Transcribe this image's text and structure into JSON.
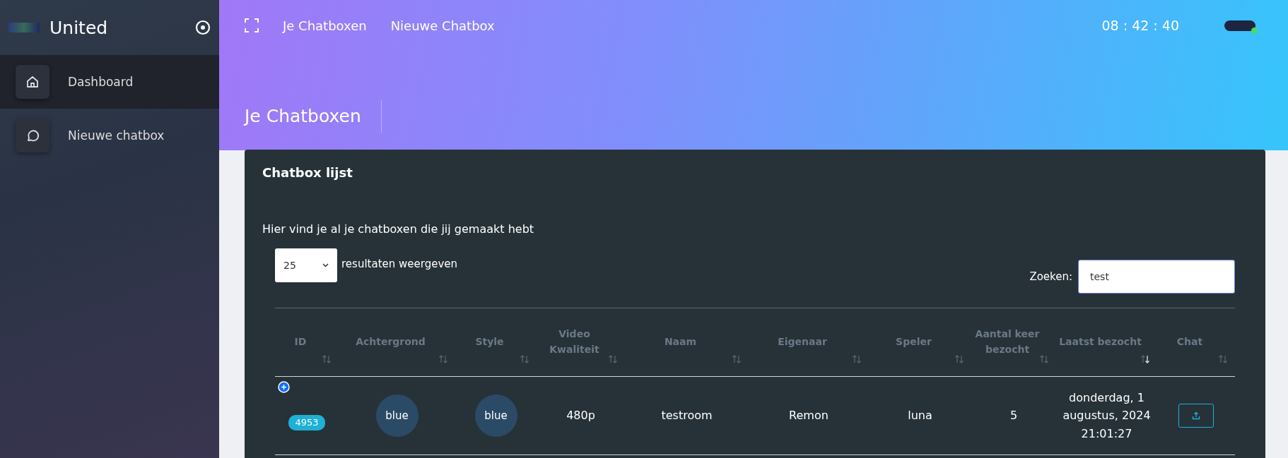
{
  "sidebar": {
    "brand": "United",
    "items": [
      {
        "label": "Dashboard",
        "kind": "home",
        "selected": true
      },
      {
        "label": "Nieuwe chatbox",
        "kind": "chat",
        "selected": false
      }
    ]
  },
  "topbar": {
    "links": [
      "Je Chatboxen",
      "Nieuwe Chatbox"
    ],
    "clock": "08 : 42 : 40"
  },
  "page_title": "Je Chatboxen",
  "card": {
    "title": "Chatbox lijst",
    "description": "Hier vind je al je chatboxen die jij gemaakt hebt",
    "page_size": "25",
    "page_size_label": "resultaten weergeven",
    "search_label": "Zoeken:",
    "search_value": "test",
    "table": {
      "columns": [
        {
          "label": "ID",
          "sorted_descending": false
        },
        {
          "label": "Achtergrond",
          "sorted_descending": false
        },
        {
          "label": "Style",
          "sorted_descending": false
        },
        {
          "label": "Video Kwaliteit",
          "sorted_descending": false
        },
        {
          "label": "Naam",
          "sorted_descending": false
        },
        {
          "label": "Eigenaar",
          "sorted_descending": false
        },
        {
          "label": "Speler",
          "sorted_descending": false
        },
        {
          "label": "Aantal keer bezocht",
          "sorted_descending": false
        },
        {
          "label": "Laatst bezocht",
          "sorted_descending": true
        },
        {
          "label": "Chat",
          "sorted_descending": false
        }
      ],
      "rows": [
        {
          "id": "4953",
          "background": "blue",
          "style": "blue",
          "quality": "480p",
          "name": "testroom",
          "owner": "Remon",
          "player": "luna",
          "visits": "5",
          "last_visited": "donderdag, 1 augustus, 2024 21:01:27"
        }
      ]
    }
  }
}
